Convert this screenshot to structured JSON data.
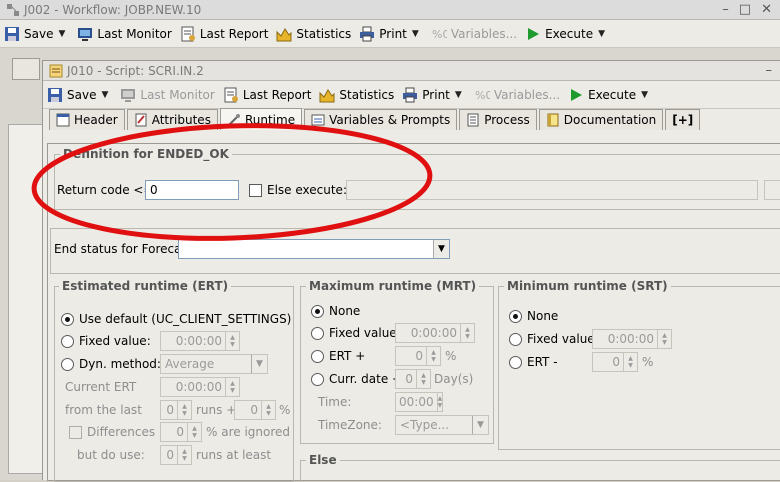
{
  "outer_window": {
    "title": "J002 - Workflow: JOBP.NEW.10",
    "toolbar": {
      "save": "Save",
      "last_monitor": "Last Monitor",
      "last_report": "Last Report",
      "statistics": "Statistics",
      "print": "Print",
      "variables": "Variables...",
      "execute": "Execute"
    }
  },
  "inner_window": {
    "title": "J010 - Script: SCRI.IN.2",
    "toolbar": {
      "save": "Save",
      "last_monitor": "Last Monitor",
      "last_report": "Last Report",
      "statistics": "Statistics",
      "print": "Print",
      "variables": "Variables...",
      "execute": "Execute"
    },
    "tabs": [
      {
        "label": "Header",
        "icon": "header-icon"
      },
      {
        "label": "Attributes",
        "icon": "attributes-icon"
      },
      {
        "label": "Runtime",
        "icon": "runtime-icon",
        "active": true
      },
      {
        "label": "Variables & Prompts",
        "icon": "variables-icon"
      },
      {
        "label": "Process",
        "icon": "process-icon"
      },
      {
        "label": "Documentation",
        "icon": "documentation-icon"
      },
      {
        "label": "[+]",
        "icon": "add-tab-icon"
      }
    ]
  },
  "ended_ok": {
    "title": "Definition for ENDED_OK",
    "return_code_label": "Return code <=:",
    "return_code_value": "0",
    "else_execute_label": "Else execute:"
  },
  "forecast": {
    "label": "End status for Forecast:",
    "value": ""
  },
  "ert": {
    "title": "Estimated runtime (ERT)",
    "use_default": "Use default (UC_CLIENT_SETTINGS)",
    "fixed_value": "Fixed value:",
    "fixed_value_val": "0:00:00",
    "dyn_method": "Dyn. method:",
    "dyn_method_val": "Average",
    "current_ert": "Current ERT",
    "current_ert_val": "0:00:00",
    "from_last": "from the last",
    "runs_val": "0",
    "runs_plus": "runs +",
    "percent_val": "0",
    "percent": "%",
    "differences": "Differences >",
    "diff_val": "0",
    "are_ignored": "% are ignored",
    "but_do_use": "but do use:",
    "use_val": "0",
    "runs_at_least": "runs at least"
  },
  "mrt": {
    "title": "Maximum runtime (MRT)",
    "none": "None",
    "fixed_value": "Fixed value:",
    "fixed_value_val": "0:00:00",
    "ert_plus": "ERT +",
    "ert_plus_val": "0",
    "percent": "%",
    "curr_date": "Curr. date +",
    "curr_date_val": "0",
    "days": "Day(s)",
    "time": "Time:",
    "time_val": "00:00",
    "timezone": "TimeZone:",
    "timezone_val": "<Type..."
  },
  "srt": {
    "title": "Minimum runtime (SRT)",
    "none": "None",
    "fixed_value": "Fixed value:",
    "fixed_value_val": "0:00:00",
    "ert_minus": "ERT -",
    "ert_minus_val": "0",
    "percent": "%"
  },
  "else_group": {
    "title": "Else"
  }
}
